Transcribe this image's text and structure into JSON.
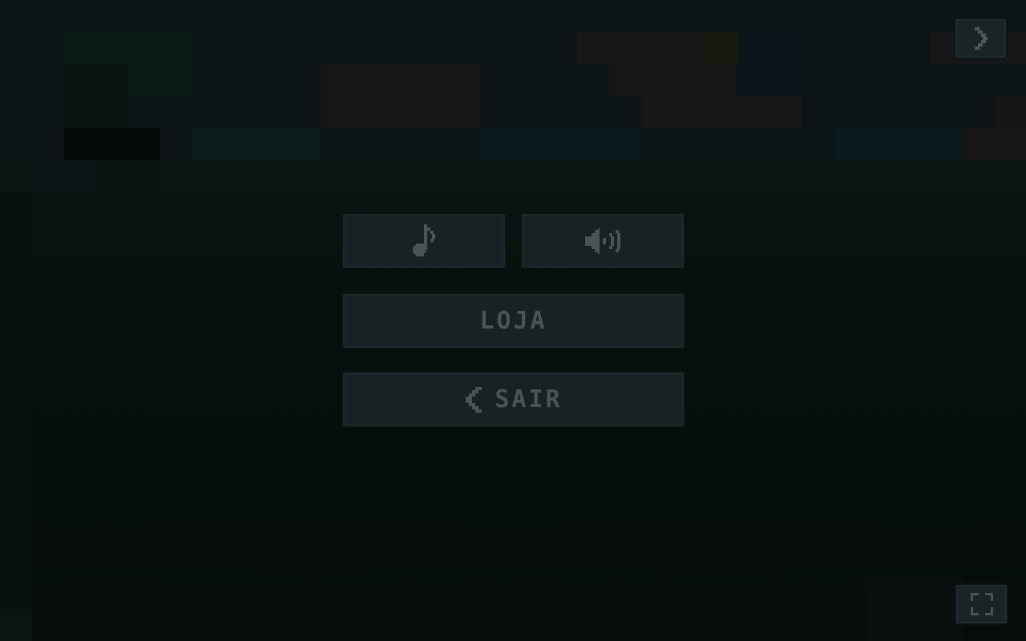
{
  "menu": {
    "music_icon": "music-note-icon",
    "sound_icon": "speaker-volume-icon",
    "shop_label": "LOJA",
    "exit_label": "SAIR",
    "exit_icon": "chevron-left-icon"
  },
  "corner": {
    "next_icon": "chevron-right-icon",
    "fullscreen_icon": "fullscreen-icon"
  },
  "colors": {
    "button_bg": "#1a2124",
    "button_text": "#4c5354",
    "background": "#050a08"
  }
}
